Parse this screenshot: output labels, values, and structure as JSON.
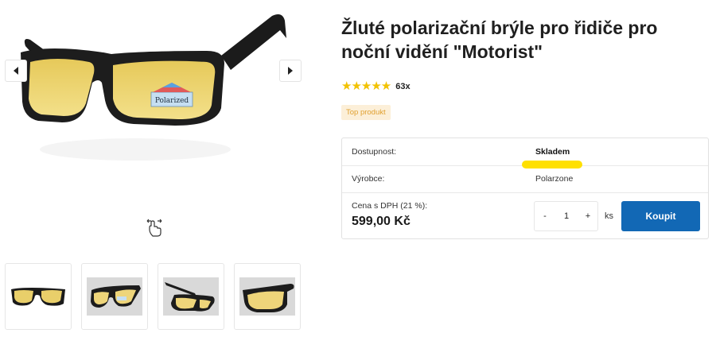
{
  "product": {
    "title": "Žluté polarizační brýle pro řidiče pro noční vidění \"Motorist\"",
    "rating_stars": "★★★★★",
    "rating_count": "63x",
    "badge": "Top produkt"
  },
  "gallery": {
    "main_image_label": "Polarized",
    "prev_icon": "chevron-left-icon",
    "next_icon": "chevron-right-icon",
    "swipe_icon": "swipe-hand-icon",
    "thumbnail_count": 4
  },
  "details": {
    "availability_label": "Dostupnost:",
    "availability_value": "Skladem",
    "manufacturer_label": "Výrobce:",
    "manufacturer_value": "Polarzone",
    "price_label": "Cena s DPH (21 %):",
    "price_value": "599,00 Kč"
  },
  "cart": {
    "minus": "-",
    "quantity": "1",
    "plus": "+",
    "unit": "ks",
    "buy_label": "Koupit"
  },
  "colors": {
    "buy_button": "#1268b5",
    "stars": "#f2c200",
    "badge_bg": "#fcefd8",
    "badge_text": "#e0a030",
    "availability_highlight": "#ffe000"
  }
}
